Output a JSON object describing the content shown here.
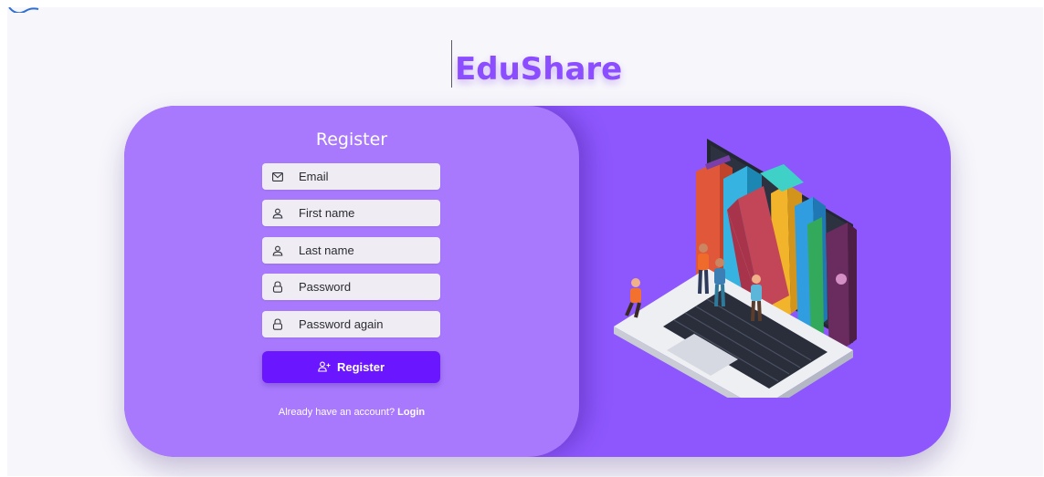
{
  "app": {
    "logo_text": "EduShare"
  },
  "form": {
    "title": "Register",
    "fields": [
      {
        "icon": "mail-icon",
        "placeholder": "Email"
      },
      {
        "icon": "user-icon",
        "placeholder": "First name"
      },
      {
        "icon": "user-icon",
        "placeholder": "Last name"
      },
      {
        "icon": "lock-icon",
        "placeholder": "Password"
      },
      {
        "icon": "lock-icon",
        "placeholder": "Password again"
      }
    ],
    "submit_label": "Register",
    "submit_icon": "user-add-icon",
    "account_prompt": "Already have an account?",
    "login_link": "Login"
  },
  "colors": {
    "brand": "#8b4dff",
    "card_background": "#8d57fd",
    "form_panel": "#a879fd",
    "button": "#6a17ff",
    "field_background": "#efedf3"
  }
}
